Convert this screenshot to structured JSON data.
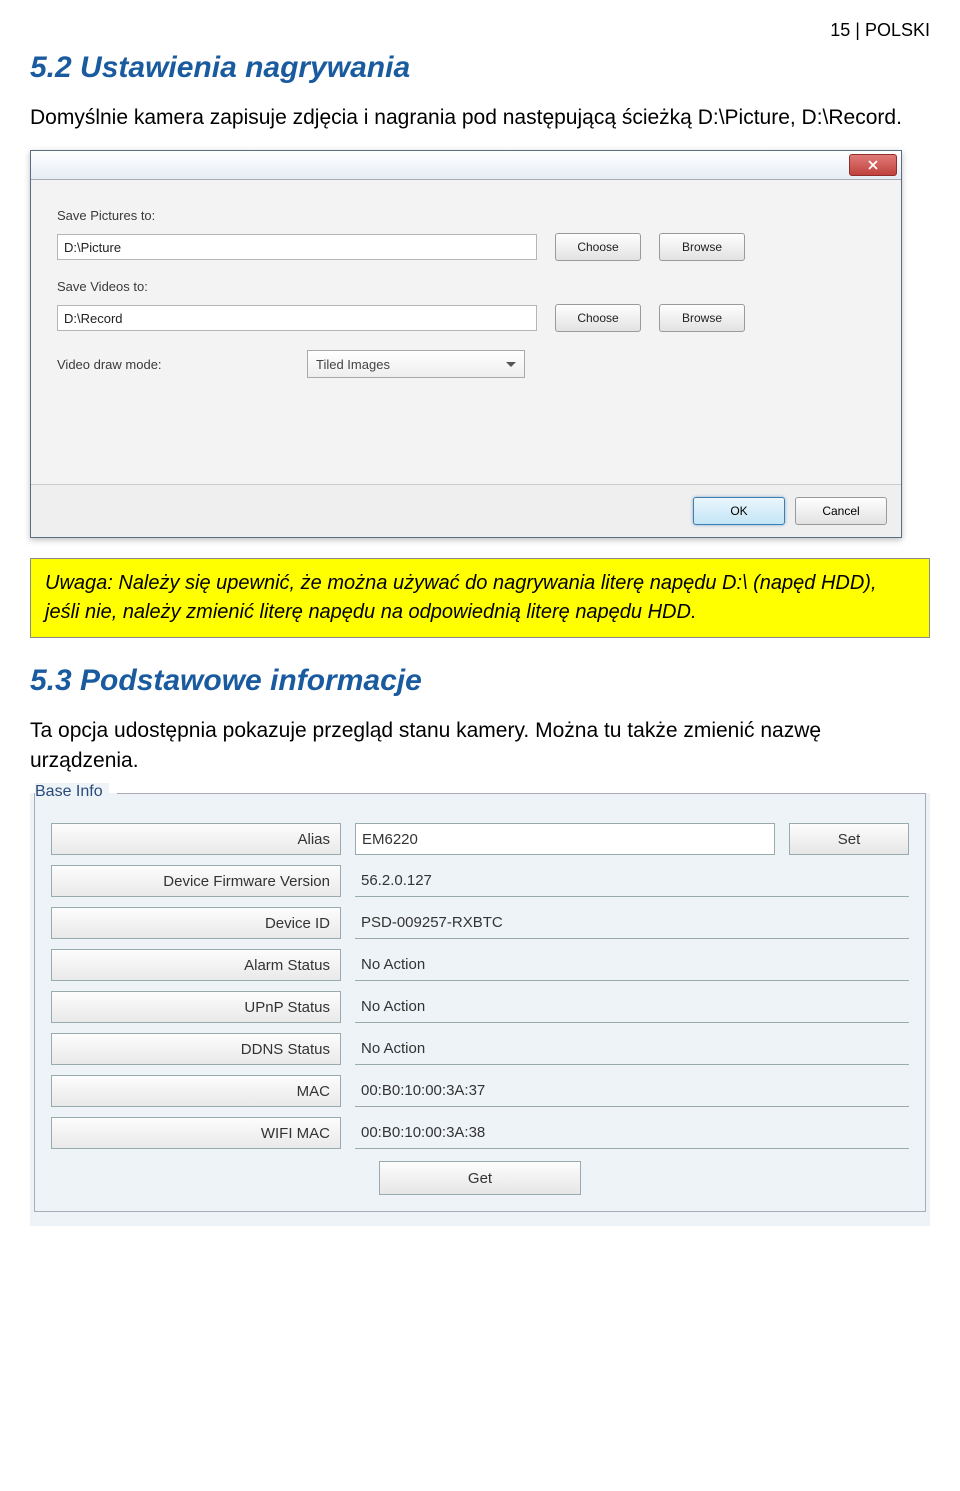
{
  "header": {
    "page_label": "15 | POLSKI"
  },
  "section52": {
    "title": "5.2 Ustawienia nagrywania",
    "intro": "Domyślnie kamera zapisuje zdjęcia i nagrania pod następującą ścieżką D:\\Picture, D:\\Record."
  },
  "dialog1": {
    "save_pictures_label": "Save Pictures to:",
    "save_pictures_value": "D:\\Picture",
    "save_videos_label": "Save Videos to:",
    "save_videos_value": "D:\\Record",
    "video_draw_label": "Video draw mode:",
    "video_draw_value": "Tiled Images",
    "choose_label": "Choose",
    "browse_label": "Browse",
    "ok_label": "OK",
    "cancel_label": "Cancel"
  },
  "note": {
    "text": "Uwaga: Należy się upewnić, że można używać do nagrywania literę napędu D:\\ (napęd HDD), jeśli nie, należy zmienić literę napędu na odpowiednią literę napędu HDD."
  },
  "section53": {
    "title": "5.3 Podstawowe informacje",
    "intro": "Ta opcja udostępnia pokazuje przegląd stanu kamery. Można tu także zmienić nazwę urządzenia."
  },
  "baseinfo": {
    "group_title": "Base Info",
    "set_label": "Set",
    "get_label": "Get",
    "rows": [
      {
        "label": "Alias",
        "value": "EM6220",
        "editable": true,
        "has_set": true
      },
      {
        "label": "Device Firmware Version",
        "value": "56.2.0.127"
      },
      {
        "label": "Device ID",
        "value": "PSD-009257-RXBTC"
      },
      {
        "label": "Alarm Status",
        "value": "No Action"
      },
      {
        "label": "UPnP Status",
        "value": "No Action"
      },
      {
        "label": "DDNS Status",
        "value": "No Action"
      },
      {
        "label": "MAC",
        "value": "00:B0:10:00:3A:37"
      },
      {
        "label": "WIFI MAC",
        "value": "00:B0:10:00:3A:38"
      }
    ]
  }
}
